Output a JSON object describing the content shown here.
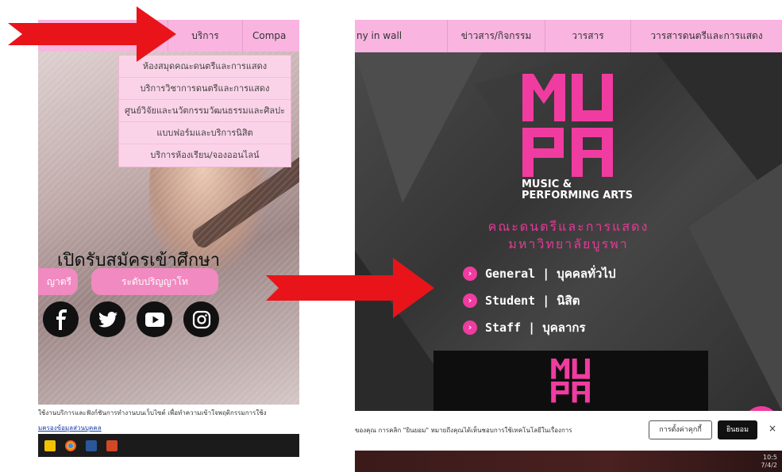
{
  "left": {
    "nav": {
      "service": "บริการ",
      "company": "Compa"
    },
    "dropdown": [
      "ห้องสมุดคณะดนตรีและการแสดง",
      "บริการวิชาการดนตรีและการแสดง",
      "ศูนย์วิจัยและนวัตกรรมวัฒนธรรมและศิลปะ",
      "แบบฟอร์มและบริการนิสิต",
      "บริการห้องเรียน/จองออนไลน์"
    ],
    "admission_title": "เปิดรับสมัครเข้าศึกษา",
    "btn_bachelor": "ญาตรี",
    "btn_master": "ระดับปริญญาโท",
    "social_icons": [
      "facebook-icon",
      "twitter-icon",
      "youtube-icon",
      "instagram-icon"
    ],
    "cookie_text": "ใช้งานบริการและฟังก์ชันการทำงานบนเว็บไซต์ เพื่อทำความเข้าใจพฤติกรรมการใช้ง",
    "cookie_link": "มครองข้อมูลส่วนบุคคล"
  },
  "right": {
    "nav": [
      "ny in wall",
      "ข่าวสาร/กิจกรรม",
      "วารสาร",
      "วารสารดนตรีและการแสดง"
    ],
    "logo_sub": [
      "MUSIC &",
      "PERFORMING ARTS"
    ],
    "faculty_th": "คณะดนตรีและการแสดง",
    "university_th": "มหาวิทยาลัยบูรพา",
    "menu": [
      "General | บุคคลทั่วไป",
      "Student | นิสิต",
      "Staff | บุคลากร"
    ],
    "cookie_text": "ของคุณ การคลิก \"ยินยอม\" หมายถึงคุณได้เห็นชอบการใช้เทคโนโลยีในเรื่องการ",
    "btn_settings": "การตั้งค่าคุกกี้",
    "btn_accept": "ยินยอม",
    "btn_close": "×",
    "clock_time": "10:5",
    "clock_date": "7/4/2"
  },
  "colors": {
    "accent_pink": "#f03ca0",
    "nav_pink": "#f9b4e0",
    "arrow_red": "#e8141a"
  }
}
